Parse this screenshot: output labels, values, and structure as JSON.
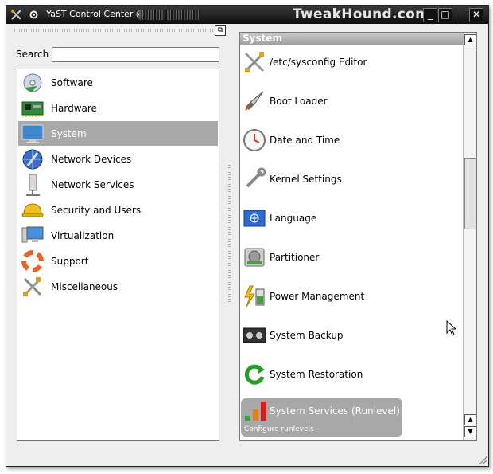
{
  "window": {
    "title": "YaST Control Center @",
    "brand": "TweakHound.com",
    "minimize": "_",
    "maximize": "□",
    "close": "✕"
  },
  "search": {
    "label": "Search",
    "value": "",
    "placeholder": ""
  },
  "categories": [
    {
      "label": "Software",
      "icon": "software-cd-icon"
    },
    {
      "label": "Hardware",
      "icon": "circuit-board-icon"
    },
    {
      "label": "System",
      "icon": "monitor-icon",
      "selected": true
    },
    {
      "label": "Network Devices",
      "icon": "globe-network-icon"
    },
    {
      "label": "Network Services",
      "icon": "server-tower-icon"
    },
    {
      "label": "Security and Users",
      "icon": "hard-hat-icon"
    },
    {
      "label": "Virtualization",
      "icon": "virtual-monitor-icon"
    },
    {
      "label": "Support",
      "icon": "lifebuoy-icon"
    },
    {
      "label": "Miscellaneous",
      "icon": "tools-icon"
    }
  ],
  "modules": {
    "header": "System",
    "items": [
      {
        "label": "/etc/sysconfig Editor",
        "icon": "wrench-screwdriver-icon"
      },
      {
        "label": "Boot Loader",
        "icon": "rocket-icon"
      },
      {
        "label": "Date and Time",
        "icon": "clock-icon"
      },
      {
        "label": "Kernel Settings",
        "icon": "wrench-icon"
      },
      {
        "label": "Language",
        "icon": "un-flag-icon"
      },
      {
        "label": "Partitioner",
        "icon": "hard-disk-icon"
      },
      {
        "label": "Power Management",
        "icon": "battery-bolt-icon"
      },
      {
        "label": "System Backup",
        "icon": "tape-icon"
      },
      {
        "label": "System Restoration",
        "icon": "green-refresh-icon"
      }
    ],
    "selected": {
      "label": "System Services (Runlevel)",
      "description": "Configure runlevels",
      "icon": "runlevel-bars-icon"
    }
  }
}
